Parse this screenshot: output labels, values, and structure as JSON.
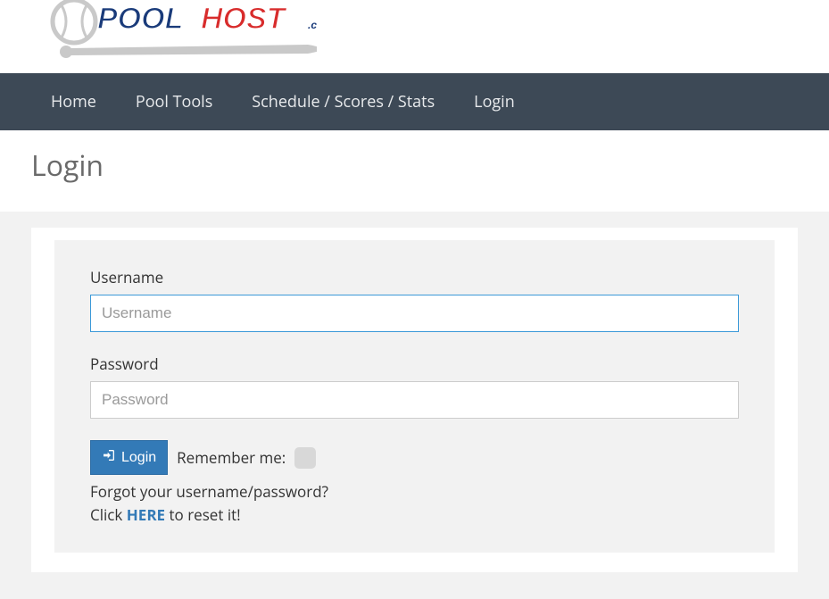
{
  "logo": {
    "text_pool": "POOL",
    "text_host": "HOST",
    "text_com": ".com"
  },
  "nav": {
    "items": [
      {
        "label": "Home"
      },
      {
        "label": "Pool Tools"
      },
      {
        "label": "Schedule / Scores / Stats"
      },
      {
        "label": "Login"
      }
    ]
  },
  "page": {
    "title": "Login"
  },
  "form": {
    "username_label": "Username",
    "username_placeholder": "Username",
    "username_value": "",
    "password_label": "Password",
    "password_placeholder": "Password",
    "password_value": "",
    "login_button": "Login",
    "remember_label": "Remember me:",
    "forgot_line1": "Forgot your username/password?",
    "forgot_line2_pre": "Click ",
    "forgot_link": "HERE",
    "forgot_line2_post": " to reset it!"
  }
}
